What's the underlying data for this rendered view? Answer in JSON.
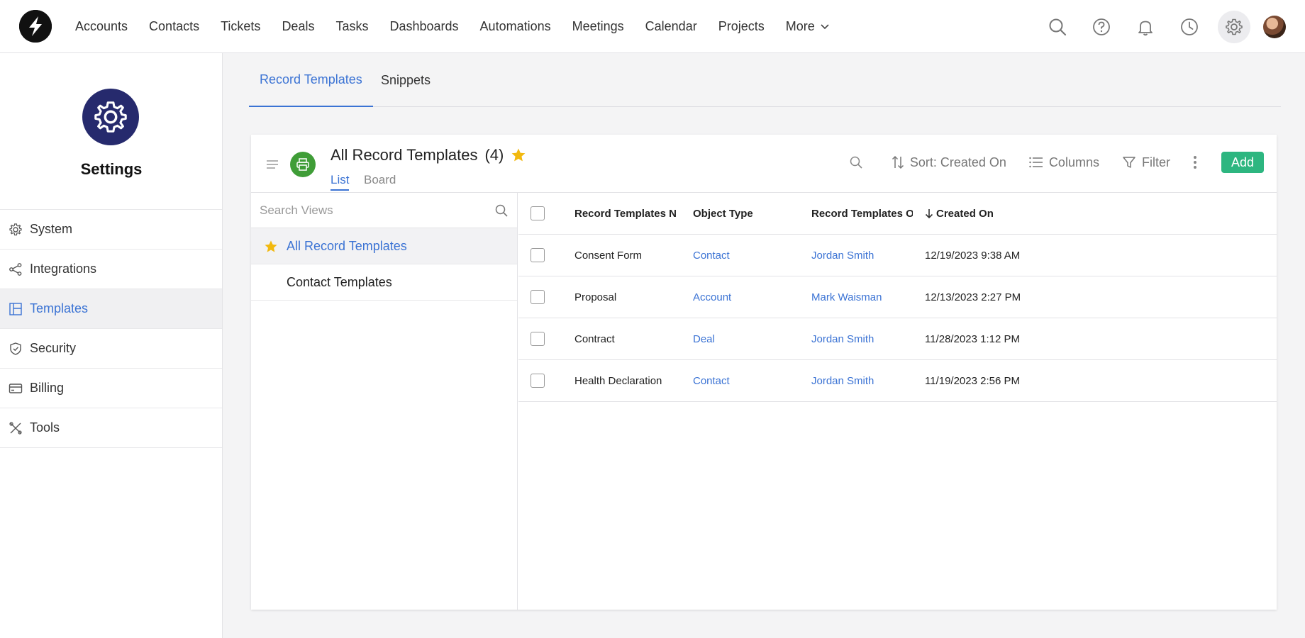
{
  "nav": {
    "items": [
      "Accounts",
      "Contacts",
      "Tickets",
      "Deals",
      "Tasks",
      "Dashboards",
      "Automations",
      "Meetings",
      "Calendar",
      "Projects"
    ],
    "more_label": "More"
  },
  "sidebar": {
    "title": "Settings",
    "items": [
      {
        "label": "System",
        "icon": "gear-icon"
      },
      {
        "label": "Integrations",
        "icon": "share-icon"
      },
      {
        "label": "Templates",
        "icon": "layout-icon"
      },
      {
        "label": "Security",
        "icon": "shield-icon"
      },
      {
        "label": "Billing",
        "icon": "card-icon"
      },
      {
        "label": "Tools",
        "icon": "tools-icon"
      }
    ],
    "active_index": 2
  },
  "tabs": [
    {
      "label": "Record Templates",
      "active": true
    },
    {
      "label": "Snippets",
      "active": false
    }
  ],
  "panel": {
    "title": "All Record Templates",
    "count": "(4)",
    "view_tabs": [
      "List",
      "Board"
    ],
    "toolbar": {
      "sort_label": "Sort: Created On",
      "columns_label": "Columns",
      "filter_label": "Filter",
      "add_label": "Add"
    },
    "views_search_placeholder": "Search Views",
    "views": [
      {
        "label": "All Record Templates",
        "active": true
      },
      {
        "label": "Contact Templates",
        "active": false
      }
    ]
  },
  "table": {
    "headers": [
      "Record Templates N",
      "Object Type",
      "Record Templates O",
      "Created On"
    ],
    "rows": [
      [
        "Consent Form",
        "Contact",
        "Jordan Smith",
        "12/19/2023 9:38 AM"
      ],
      [
        "Proposal",
        "Account",
        "Mark Waisman",
        "12/13/2023 2:27 PM"
      ],
      [
        "Contract",
        "Deal",
        "Jordan Smith",
        "11/28/2023 1:12 PM"
      ],
      [
        "Health Declaration",
        "Contact",
        "Jordan Smith",
        "11/19/2023 2:56 PM"
      ]
    ]
  },
  "colors": {
    "accent": "#3b73d4",
    "add_button": "#2db680",
    "settings_avatar": "#262a6d",
    "print_icon_bg": "#3f9d37",
    "star": "#f2b90f"
  }
}
